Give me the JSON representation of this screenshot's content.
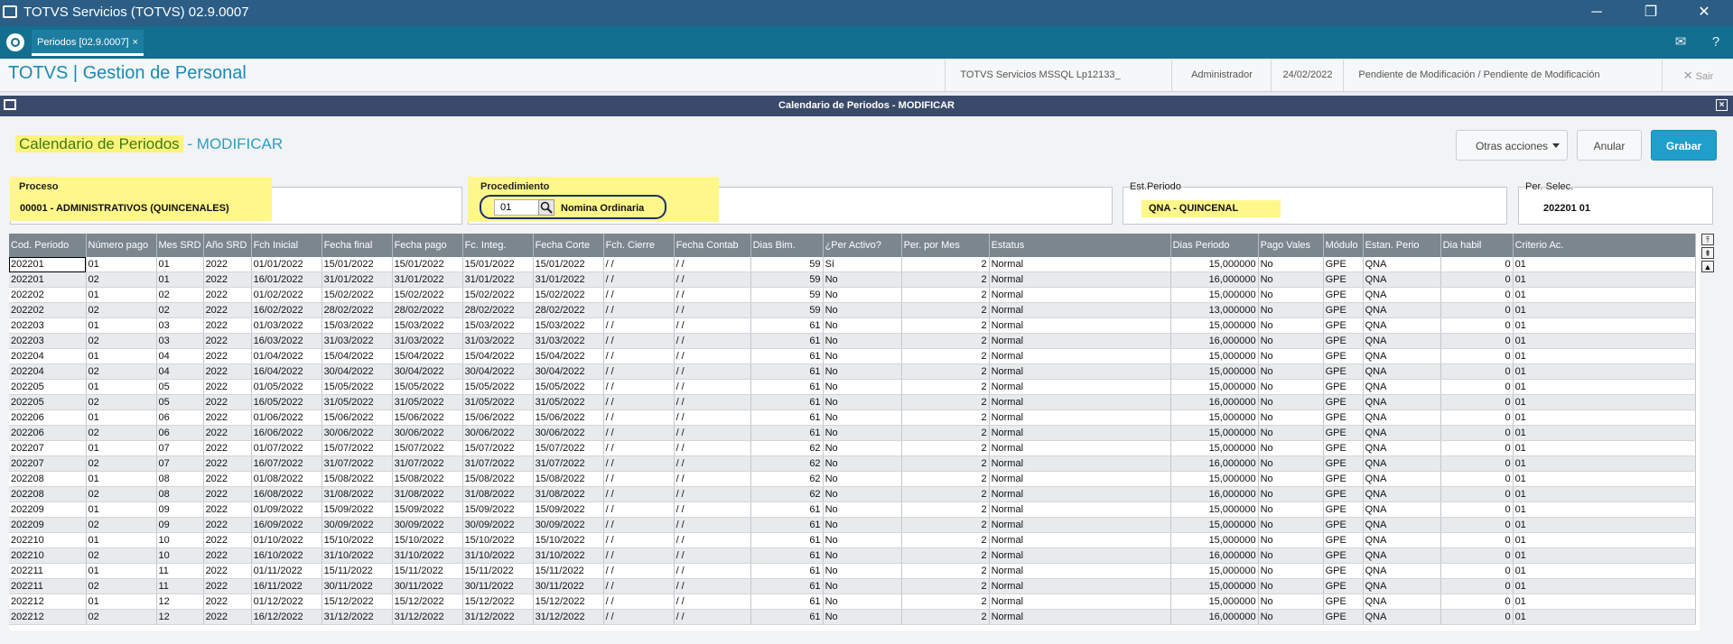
{
  "window": {
    "title": "TOTVS Servicios (TOTVS) 02.9.0007",
    "minimize": "─",
    "maximize": "❐",
    "close": "✕"
  },
  "tabs": {
    "active_label": "Periodos [02.9.0007]",
    "close_glyph": "×",
    "mail_glyph": "✉",
    "help_glyph": "?"
  },
  "header": {
    "brand": "TOTVS | Gestion de Personal",
    "environment": "TOTVS Servicios MSSQL Lp12133_",
    "user": "Administrador",
    "date": "24/02/2022",
    "status": "Pendiente de Modificación / Pendiente de Modificación",
    "exit_label": "Sair",
    "exit_glyph": "✕"
  },
  "dialog": {
    "title": "Calendario de Periodos - MODIFICAR",
    "close_glyph": "×"
  },
  "form": {
    "title_main": "Calendario de Periodos",
    "title_suffix": " - MODIFICAR",
    "buttons": {
      "other_actions": "Otras acciones",
      "cancel": "Anular",
      "save": "Grabar"
    },
    "proceso": {
      "label": "Proceso",
      "value": "00001 - ADMINISTRATIVOS (QUINCENALES)"
    },
    "procedimiento": {
      "label": "Procedimiento",
      "code": "01",
      "description": "Nomina Ordinaria"
    },
    "est_periodo": {
      "label": "Est.Periodo",
      "value": "QNA - QUINCENAL"
    },
    "per_selec": {
      "label": "Per. Selec.",
      "value": "202201 01"
    }
  },
  "colors": {
    "highlight": "#fff78a",
    "accent": "#1f9fcb",
    "titlebar": "#2b5d85"
  },
  "grid": {
    "columns": [
      "Cod. Periodo",
      "Número pago",
      "Mes SRD",
      "Año SRD",
      "Fch Inicial",
      "Fecha final",
      "Fecha pago",
      "Fc. Integ.",
      "Fecha Corte",
      "Fch. Cierre",
      "Fecha Contab",
      "Dias Bim.",
      "¿Per Activo?",
      "Per. por Mes",
      "Estatus",
      "Dias Periodo",
      "Pago Vales",
      "Módulo",
      "Estan. Perio",
      "Dia habil",
      "Criterio Ac."
    ],
    "rows": [
      [
        "202201",
        "01",
        "01",
        "2022",
        "01/01/2022",
        "15/01/2022",
        "15/01/2022",
        "15/01/2022",
        "15/01/2022",
        " / /",
        " / /",
        "59",
        "Sí",
        "2",
        "Normal",
        "15,000000",
        "No",
        "GPE",
        "QNA",
        "0",
        "01"
      ],
      [
        "202201",
        "02",
        "01",
        "2022",
        "16/01/2022",
        "31/01/2022",
        "31/01/2022",
        "31/01/2022",
        "31/01/2022",
        " / /",
        " / /",
        "59",
        "No",
        "2",
        "Normal",
        "16,000000",
        "No",
        "GPE",
        "QNA",
        "0",
        "01"
      ],
      [
        "202202",
        "01",
        "02",
        "2022",
        "01/02/2022",
        "15/02/2022",
        "15/02/2022",
        "15/02/2022",
        "15/02/2022",
        " / /",
        " / /",
        "59",
        "No",
        "2",
        "Normal",
        "15,000000",
        "No",
        "GPE",
        "QNA",
        "0",
        "01"
      ],
      [
        "202202",
        "02",
        "02",
        "2022",
        "16/02/2022",
        "28/02/2022",
        "28/02/2022",
        "28/02/2022",
        "28/02/2022",
        " / /",
        " / /",
        "59",
        "No",
        "2",
        "Normal",
        "13,000000",
        "No",
        "GPE",
        "QNA",
        "0",
        "01"
      ],
      [
        "202203",
        "01",
        "03",
        "2022",
        "01/03/2022",
        "15/03/2022",
        "15/03/2022",
        "15/03/2022",
        "15/03/2022",
        " / /",
        " / /",
        "61",
        "No",
        "2",
        "Normal",
        "15,000000",
        "No",
        "GPE",
        "QNA",
        "0",
        "01"
      ],
      [
        "202203",
        "02",
        "03",
        "2022",
        "16/03/2022",
        "31/03/2022",
        "31/03/2022",
        "31/03/2022",
        "31/03/2022",
        " / /",
        " / /",
        "61",
        "No",
        "2",
        "Normal",
        "16,000000",
        "No",
        "GPE",
        "QNA",
        "0",
        "01"
      ],
      [
        "202204",
        "01",
        "04",
        "2022",
        "01/04/2022",
        "15/04/2022",
        "15/04/2022",
        "15/04/2022",
        "15/04/2022",
        " / /",
        " / /",
        "61",
        "No",
        "2",
        "Normal",
        "15,000000",
        "No",
        "GPE",
        "QNA",
        "0",
        "01"
      ],
      [
        "202204",
        "02",
        "04",
        "2022",
        "16/04/2022",
        "30/04/2022",
        "30/04/2022",
        "30/04/2022",
        "30/04/2022",
        " / /",
        " / /",
        "61",
        "No",
        "2",
        "Normal",
        "15,000000",
        "No",
        "GPE",
        "QNA",
        "0",
        "01"
      ],
      [
        "202205",
        "01",
        "05",
        "2022",
        "01/05/2022",
        "15/05/2022",
        "15/05/2022",
        "15/05/2022",
        "15/05/2022",
        " / /",
        " / /",
        "61",
        "No",
        "2",
        "Normal",
        "15,000000",
        "No",
        "GPE",
        "QNA",
        "0",
        "01"
      ],
      [
        "202205",
        "02",
        "05",
        "2022",
        "16/05/2022",
        "31/05/2022",
        "31/05/2022",
        "31/05/2022",
        "31/05/2022",
        " / /",
        " / /",
        "61",
        "No",
        "2",
        "Normal",
        "16,000000",
        "No",
        "GPE",
        "QNA",
        "0",
        "01"
      ],
      [
        "202206",
        "01",
        "06",
        "2022",
        "01/06/2022",
        "15/06/2022",
        "15/06/2022",
        "15/06/2022",
        "15/06/2022",
        " / /",
        " / /",
        "61",
        "No",
        "2",
        "Normal",
        "15,000000",
        "No",
        "GPE",
        "QNA",
        "0",
        "01"
      ],
      [
        "202206",
        "02",
        "06",
        "2022",
        "16/06/2022",
        "30/06/2022",
        "30/06/2022",
        "30/06/2022",
        "30/06/2022",
        " / /",
        " / /",
        "61",
        "No",
        "2",
        "Normal",
        "15,000000",
        "No",
        "GPE",
        "QNA",
        "0",
        "01"
      ],
      [
        "202207",
        "01",
        "07",
        "2022",
        "01/07/2022",
        "15/07/2022",
        "15/07/2022",
        "15/07/2022",
        "15/07/2022",
        " / /",
        " / /",
        "62",
        "No",
        "2",
        "Normal",
        "15,000000",
        "No",
        "GPE",
        "QNA",
        "0",
        "01"
      ],
      [
        "202207",
        "02",
        "07",
        "2022",
        "16/07/2022",
        "31/07/2022",
        "31/07/2022",
        "31/07/2022",
        "31/07/2022",
        " / /",
        " / /",
        "62",
        "No",
        "2",
        "Normal",
        "16,000000",
        "No",
        "GPE",
        "QNA",
        "0",
        "01"
      ],
      [
        "202208",
        "01",
        "08",
        "2022",
        "01/08/2022",
        "15/08/2022",
        "15/08/2022",
        "15/08/2022",
        "15/08/2022",
        " / /",
        " / /",
        "62",
        "No",
        "2",
        "Normal",
        "15,000000",
        "No",
        "GPE",
        "QNA",
        "0",
        "01"
      ],
      [
        "202208",
        "02",
        "08",
        "2022",
        "16/08/2022",
        "31/08/2022",
        "31/08/2022",
        "31/08/2022",
        "31/08/2022",
        " / /",
        " / /",
        "62",
        "No",
        "2",
        "Normal",
        "16,000000",
        "No",
        "GPE",
        "QNA",
        "0",
        "01"
      ],
      [
        "202209",
        "01",
        "09",
        "2022",
        "01/09/2022",
        "15/09/2022",
        "15/09/2022",
        "15/09/2022",
        "15/09/2022",
        " / /",
        " / /",
        "61",
        "No",
        "2",
        "Normal",
        "15,000000",
        "No",
        "GPE",
        "QNA",
        "0",
        "01"
      ],
      [
        "202209",
        "02",
        "09",
        "2022",
        "16/09/2022",
        "30/09/2022",
        "30/09/2022",
        "30/09/2022",
        "30/09/2022",
        " / /",
        " / /",
        "61",
        "No",
        "2",
        "Normal",
        "15,000000",
        "No",
        "GPE",
        "QNA",
        "0",
        "01"
      ],
      [
        "202210",
        "01",
        "10",
        "2022",
        "01/10/2022",
        "15/10/2022",
        "15/10/2022",
        "15/10/2022",
        "15/10/2022",
        " / /",
        " / /",
        "61",
        "No",
        "2",
        "Normal",
        "15,000000",
        "No",
        "GPE",
        "QNA",
        "0",
        "01"
      ],
      [
        "202210",
        "02",
        "10",
        "2022",
        "16/10/2022",
        "31/10/2022",
        "31/10/2022",
        "31/10/2022",
        "31/10/2022",
        " / /",
        " / /",
        "61",
        "No",
        "2",
        "Normal",
        "16,000000",
        "No",
        "GPE",
        "QNA",
        "0",
        "01"
      ],
      [
        "202211",
        "01",
        "11",
        "2022",
        "01/11/2022",
        "15/11/2022",
        "15/11/2022",
        "15/11/2022",
        "15/11/2022",
        " / /",
        " / /",
        "61",
        "No",
        "2",
        "Normal",
        "15,000000",
        "No",
        "GPE",
        "QNA",
        "0",
        "01"
      ],
      [
        "202211",
        "02",
        "11",
        "2022",
        "16/11/2022",
        "30/11/2022",
        "30/11/2022",
        "30/11/2022",
        "30/11/2022",
        " / /",
        " / /",
        "61",
        "No",
        "2",
        "Normal",
        "15,000000",
        "No",
        "GPE",
        "QNA",
        "0",
        "01"
      ],
      [
        "202212",
        "01",
        "12",
        "2022",
        "01/12/2022",
        "15/12/2022",
        "15/12/2022",
        "15/12/2022",
        "15/12/2022",
        " / /",
        " / /",
        "61",
        "No",
        "2",
        "Normal",
        "15,000000",
        "No",
        "GPE",
        "QNA",
        "0",
        "01"
      ],
      [
        "202212",
        "02",
        "12",
        "2022",
        "16/12/2022",
        "31/12/2022",
        "31/12/2022",
        "31/12/2022",
        "31/12/2022",
        " / /",
        " / /",
        "61",
        "No",
        "2",
        "Normal",
        "16,000000",
        "No",
        "GPE",
        "QNA",
        "0",
        "01"
      ]
    ]
  }
}
